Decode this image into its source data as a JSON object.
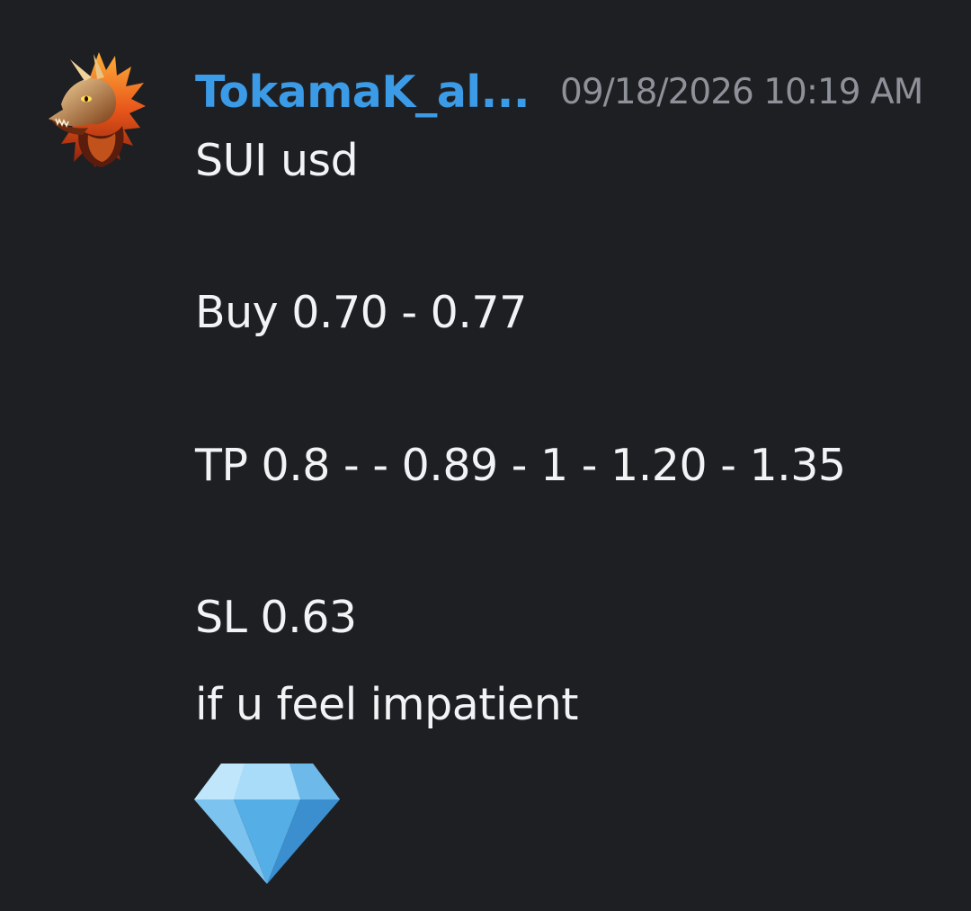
{
  "message": {
    "author": "TokamaK_al...",
    "timestamp": "09/18/2026 10:19 AM",
    "lines": [
      "SUI usd",
      "Buy 0.70 - 0.77",
      "TP 0.8 - - 0.89 - 1 - 1.20 - 1.35",
      "SL 0.63",
      "if u feel impatient"
    ],
    "emoji": "gem-emoji"
  },
  "avatar_icon": "dragon-avatar-icon",
  "colors": {
    "background": "#1e1f22",
    "username": "#3b9be6",
    "timestamp": "#8e9199",
    "text": "#f2f3f5"
  }
}
